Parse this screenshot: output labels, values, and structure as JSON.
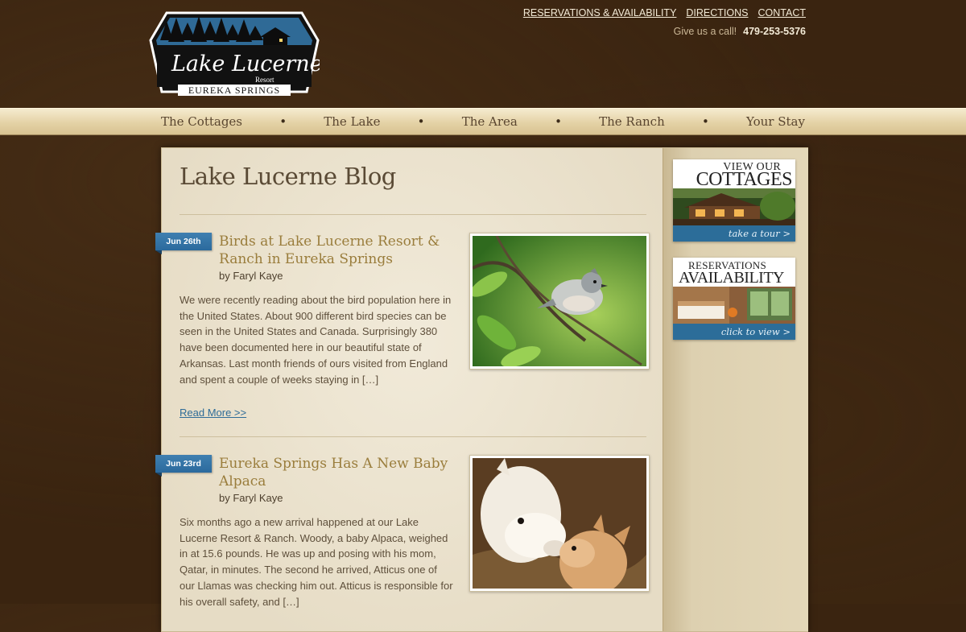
{
  "site": {
    "logo": {
      "name_line1": "Lake Lucerne",
      "name_line2": "Resort",
      "location": "EUREKA SPRINGS"
    },
    "top_links": [
      "RESERVATIONS & AVAILABILITY",
      "DIRECTIONS",
      "CONTACT"
    ],
    "call_prompt": "Give us a call!",
    "phone": "479-253-5376"
  },
  "nav": {
    "items": [
      "The Cottages",
      "The Lake",
      "The Area",
      "The Ranch",
      "Your Stay"
    ],
    "separator": "•"
  },
  "page": {
    "title": "Lake Lucerne Blog"
  },
  "posts": [
    {
      "date": "Jun 26th",
      "title": "Birds at Lake Lucerne Resort & Ranch in Eureka Springs",
      "author": "by Faryl Kaye",
      "excerpt": "We were recently reading about the bird population here in the United States.   About 900 different bird species can be seen in the United States and Canada. Surprisingly 380 have been documented here in our beautiful state of Arkansas.  Last month friends of ours visited from England and spent a couple of weeks staying in […]",
      "read_more": "Read More >>"
    },
    {
      "date": "Jun 23rd",
      "title": "Eureka Springs Has A New Baby Alpaca",
      "author": "by Faryl Kaye",
      "excerpt": "Six months ago a new arrival happened at our Lake Lucerne Resort & Ranch. Woody, a baby Alpaca,  weighed in at 15.6 pounds. He was up and posing with his mom, Qatar, in minutes. The second he arrived, Atticus one of our Llamas was checking him out. Atticus is responsible for his overall safety, and […]"
    }
  ],
  "sidebar": {
    "promos": [
      {
        "line1": "VIEW OUR",
        "line2": "COTTAGES",
        "cta": "take a tour  >"
      },
      {
        "line1": "RESERVATIONS",
        "line2": "AVAILABILITY",
        "cta": "click to view  >"
      }
    ]
  },
  "colors": {
    "background": "#3a2410",
    "nav_bar": "#e4d2a6",
    "accent_blue": "#2c6d99",
    "post_title": "#9a7d3c"
  }
}
